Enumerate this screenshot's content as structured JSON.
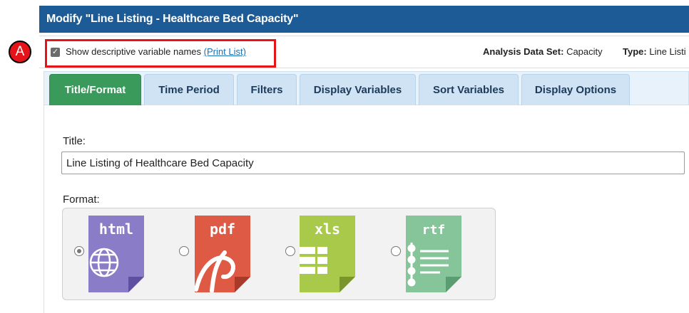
{
  "dialog": {
    "title": "Modify \"Line Listing - Healthcare Bed Capacity\""
  },
  "annotation": {
    "marker_label": "A",
    "marker_color": "#e5141a"
  },
  "options": {
    "show_descriptive_label": "Show descriptive variable names",
    "show_descriptive_checked": true,
    "print_list_link": "(Print List)",
    "analysis_data_set_label": "Analysis Data Set:",
    "analysis_data_set_value": "Capacity",
    "type_label": "Type:",
    "type_value": "Line Listi"
  },
  "tabs": [
    {
      "label": "Title/Format",
      "active": true
    },
    {
      "label": "Time Period",
      "active": false
    },
    {
      "label": "Filters",
      "active": false
    },
    {
      "label": "Display Variables",
      "active": false
    },
    {
      "label": "Sort Variables",
      "active": false
    },
    {
      "label": "Display Options",
      "active": false
    }
  ],
  "form": {
    "title_label": "Title:",
    "title_value": "Line Listing of Healthcare Bed Capacity",
    "format_label": "Format:",
    "formats": [
      {
        "name": "html",
        "selected": true,
        "color": "#8a7cc6",
        "icon": "globe-icon"
      },
      {
        "name": "pdf",
        "selected": false,
        "color": "#df5a44",
        "icon": "acrobat-icon"
      },
      {
        "name": "xls",
        "selected": false,
        "color": "#a9c94a",
        "icon": "grid-icon"
      },
      {
        "name": "rtf",
        "selected": false,
        "color": "#86c49a",
        "icon": "lines-icon"
      }
    ]
  },
  "colors": {
    "titlebar": "#1d5b96",
    "active_tab": "#3a9a5b",
    "inactive_tab": "#cfe3f4",
    "link": "#1a6fb5"
  }
}
